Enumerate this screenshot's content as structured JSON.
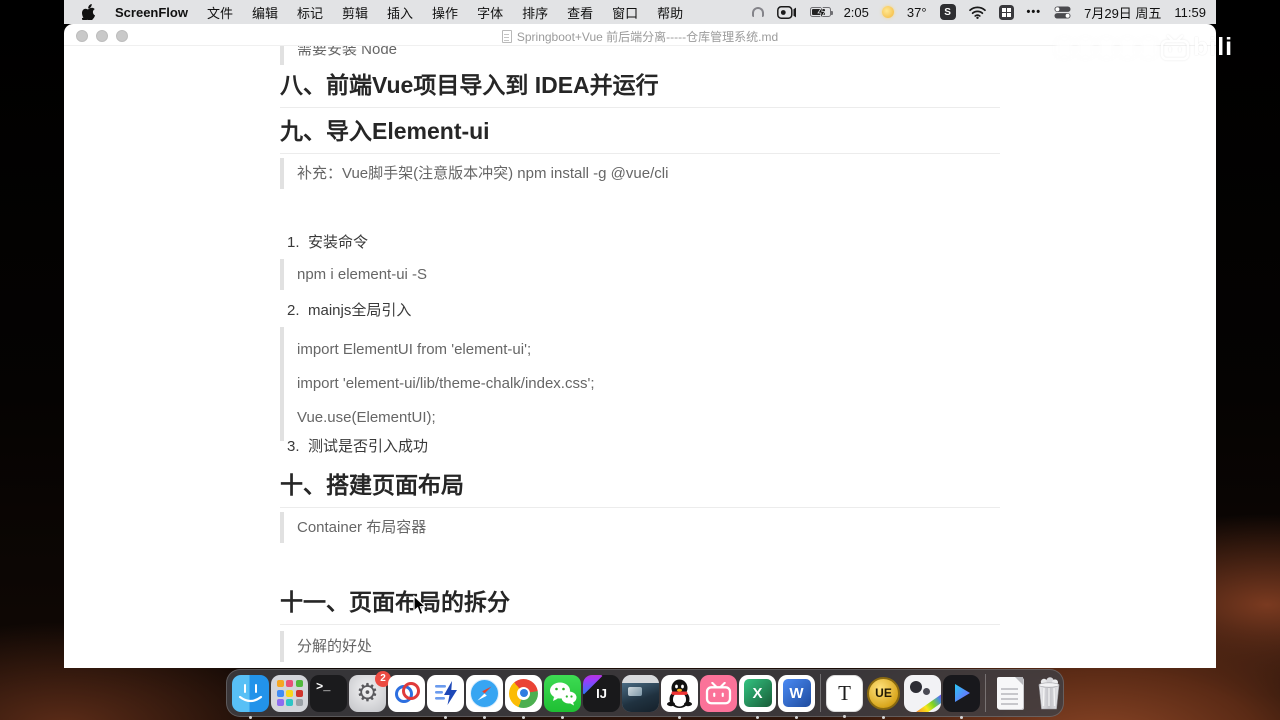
{
  "menu_bar": {
    "app_name": "ScreenFlow",
    "menus": [
      "文件",
      "编辑",
      "标记",
      "剪辑",
      "插入",
      "操作",
      "字体",
      "排序",
      "查看",
      "窗口",
      "帮助"
    ],
    "status": {
      "recording_time": "2:05",
      "temperature": "37°",
      "settings_letter": "S",
      "more": "•••",
      "date": "7月29日 周五",
      "time": "11:59"
    }
  },
  "window": {
    "title": "Springboot+Vue 前后端分离-----仓库管理系统.md"
  },
  "document": {
    "clipped_line": "需要安装 Node",
    "h2_8": "八、前端Vue项目导入到 IDEA并运行",
    "h2_9": "九、导入Element-ui",
    "bq_supplement": "补充：Vue脚手架(注意版本冲突)   npm install -g @vue/cli",
    "list": [
      {
        "num": "1.",
        "text": "安装命令"
      },
      {
        "num": "2.",
        "text": "mainjs全局引入"
      },
      {
        "num": "3.",
        "text": "测试是否引入成功"
      }
    ],
    "bq_npm": "npm i element-ui -S",
    "bq_imports": [
      "import ElementUI from 'element-ui';",
      "import 'element-ui/lib/theme-chalk/index.css';",
      "Vue.use(ElementUI);"
    ],
    "h2_10": "十、搭建页面布局",
    "bq_container": "Container 布局容器",
    "h2_11": "十一、页面布局的拆分",
    "bq_split": "分解的好处"
  },
  "watermark": {
    "brand": "bili"
  },
  "dock": {
    "settings_badge": "2",
    "terminal_glyph": ">_",
    "idea_label": "IJ",
    "excel_label": "X",
    "word_label": "W",
    "typora_label": "T",
    "ultraedit_label": "UE",
    "apps": [
      "finder",
      "launchpad",
      "terminal",
      "system-settings",
      "network-knot-app",
      "lightning-docs-app",
      "safari",
      "chrome",
      "wechat",
      "intellij-idea",
      "minimized-window",
      "qq",
      "bilibili",
      "excel",
      "word",
      "typora",
      "ultraedit",
      "screenflow",
      "video-player",
      "documents-stack",
      "trash"
    ]
  }
}
